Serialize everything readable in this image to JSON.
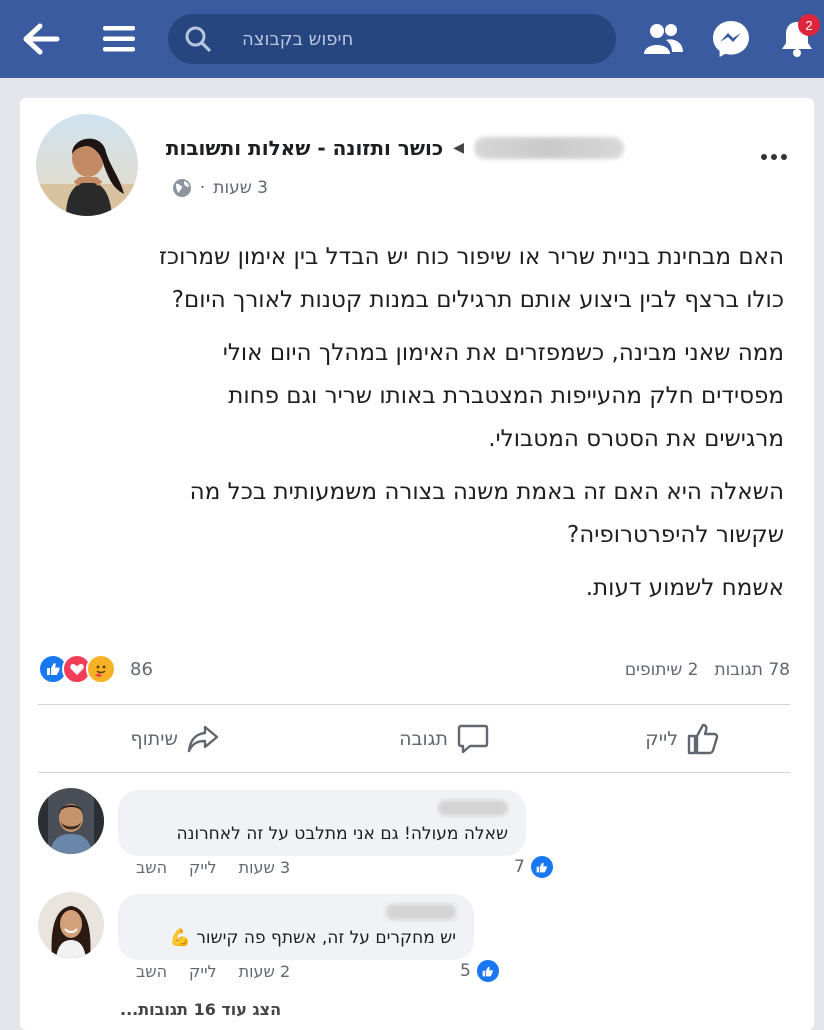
{
  "topbar": {
    "search_placeholder": "חיפוש בקבוצה",
    "notifications_count": "2",
    "bar_color": "#3b5ba0"
  },
  "post": {
    "group_name": "כושר ותזונה - שאלות ותשובות",
    "time": "3 שעות",
    "dot": "·",
    "paragraphs": [
      "האם מבחינת בניית שריר או שיפור כוח יש הבדל בין אימון שמרוכז כולו ברצף לבין ביצוע אותם תרגילים במנות קטנות לאורך היום?",
      "ממה שאני מבינה, כשמפזרים את האימון במהלך היום אולי מפסידים חלק מהעייפות המצטברת באותו שריר וגם פחות מרגישים את הסטרס המטבולי.",
      "השאלה היא האם זה באמת משנה בצורה משמעותית בכל מה שקשור להיפרטרופיה?",
      "אשמח לשמוע דעות."
    ],
    "reactions_count": "86",
    "comments_count": "78 תגובות",
    "shares_count": "2 שיתופים"
  },
  "actions": {
    "like": "לייק",
    "comment": "תגובה",
    "share": "שיתוף"
  },
  "comments": [
    {
      "text": "שאלה מעולה! גם אני מתלבט על זה לאחרונה",
      "time": "3 שעות",
      "like": "לייק",
      "reply": "השב",
      "likes": "7"
    },
    {
      "text": "יש מחקרים על זה, אשתף פה קישור 💪",
      "time": "2 שעות",
      "like": "לייק",
      "reply": "השב",
      "likes": "5"
    }
  ],
  "more_comments": "הצג עוד 16 תגובות...",
  "icons": {
    "back": "back-arrow-icon",
    "menu": "hamburger-icon",
    "search": "search-icon",
    "groups": "groups-icon",
    "messenger": "messenger-icon",
    "bell": "bell-icon",
    "globe": "globe-icon",
    "more": "more-dots-icon"
  }
}
